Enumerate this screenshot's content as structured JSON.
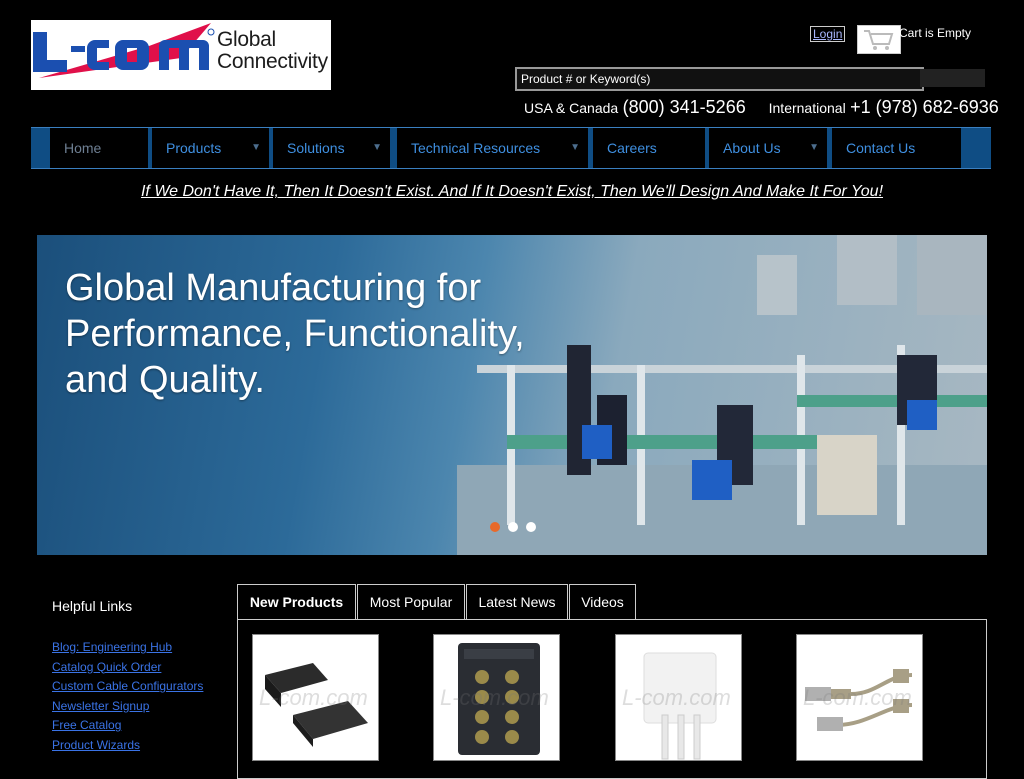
{
  "logo": {
    "text_line1": "Global",
    "text_line2": "Connectivity",
    "brand_colors": [
      "#1b4fb0",
      "#e0104a"
    ]
  },
  "header": {
    "login_label": "Login",
    "cart_text": "Cart is Empty",
    "cart_icon": "shopping-cart-icon",
    "search_placeholder": "Product # or Keyword(s)",
    "usa_label": "USA & Canada",
    "usa_phone": "(800) 341-5266",
    "intl_label": "International",
    "intl_phone": "+1 (978) 682-6936"
  },
  "nav": {
    "items": [
      {
        "label": "Home"
      },
      {
        "label": "Products"
      },
      {
        "label": "Solutions"
      },
      {
        "label": "Technical Resources"
      },
      {
        "label": "Careers"
      },
      {
        "label": "About Us"
      },
      {
        "label": "Contact Us"
      }
    ]
  },
  "tagline": "If We Don't Have It, Then It Doesn't Exist. And If It Doesn't Exist, Then We'll Design And Make It For You!",
  "hero": {
    "line1": "Global Manufacturing for",
    "line2": "Performance, Functionality,",
    "line3": "and Quality.",
    "active_slide": 1,
    "slide_count": 3,
    "active_dot_color": "#e8692a"
  },
  "helpful": {
    "title": "Helpful Links",
    "links": [
      "Blog: Engineering Hub",
      "Catalog Quick Order",
      "Custom Cable Configurators",
      "Newsletter Signup",
      "Free Catalog",
      "Product Wizards"
    ]
  },
  "tabs": {
    "items": [
      "New Products",
      "Most Popular",
      "Latest News",
      "Videos"
    ],
    "active": "New Products"
  },
  "products": {
    "watermark": "L-com.com"
  }
}
